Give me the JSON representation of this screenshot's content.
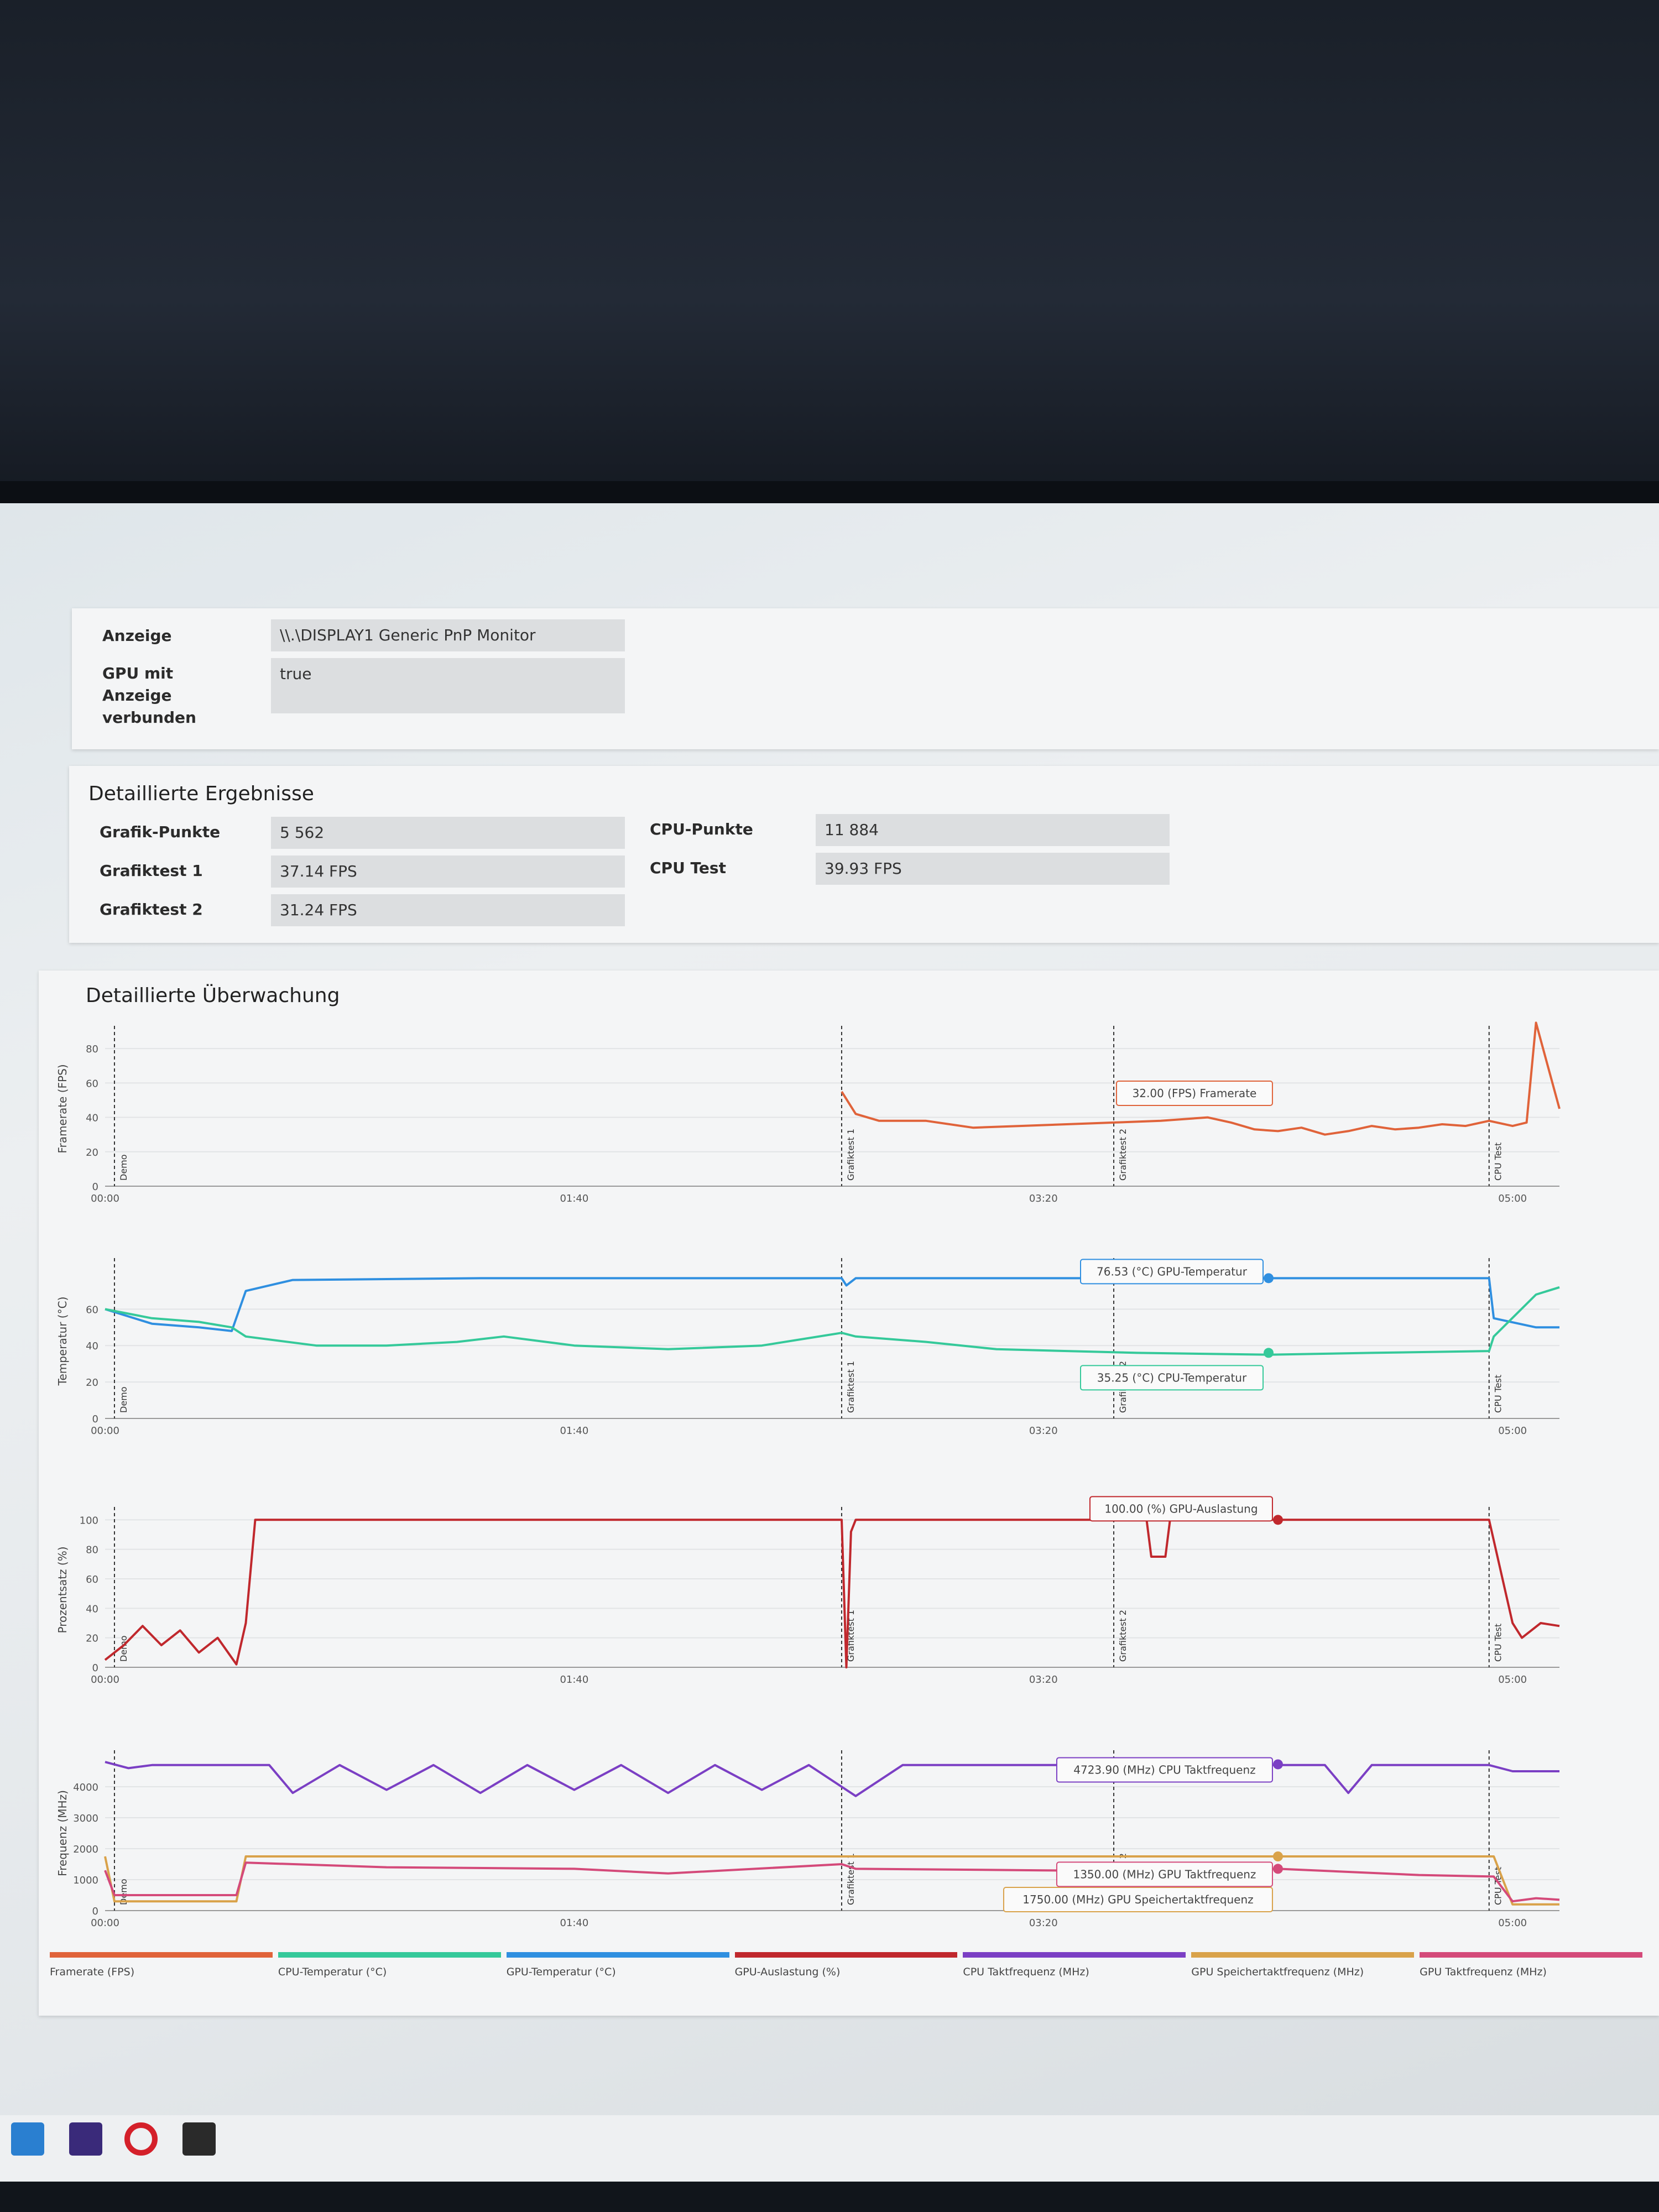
{
  "display": {
    "rows": [
      {
        "label": "Anzeige",
        "value": "\\\\.\\DISPLAY1 Generic PnP Monitor"
      },
      {
        "label": "GPU mit Anzeige verbunden",
        "value": "true"
      }
    ]
  },
  "results": {
    "title": "Detaillierte Ergebnisse",
    "left": [
      {
        "label": "Grafik-Punkte",
        "value": "5 562"
      },
      {
        "label": "Grafiktest 1",
        "value": "37.14 FPS"
      },
      {
        "label": "Grafiktest 2",
        "value": "31.24 FPS"
      }
    ],
    "right": [
      {
        "label": "CPU-Punkte",
        "value": "11 884"
      },
      {
        "label": "CPU Test",
        "value": "39.93 FPS"
      }
    ]
  },
  "monitoring": {
    "title": "Detaillierte Überwachung",
    "phase_labels": [
      "Demo",
      "Grafiktest 1",
      "Grafiktest 2",
      "CPU Test"
    ],
    "tooltips": {
      "fps": "32.00 (FPS) Framerate",
      "gpu_temp": "76.53 (°C) GPU-Temperatur",
      "cpu_temp": "35.25 (°C) CPU-Temperatur",
      "gpu_load": "100.00 (%) GPU-Auslastung",
      "cpu_clock": "4723.90 (MHz) CPU Taktfrequenz",
      "gpu_mem_clock": "1750.00 (MHz) GPU Speichertaktfrequenz",
      "gpu_clock": "1350.00 (MHz) GPU Taktfrequenz"
    }
  },
  "legend": [
    {
      "label": "Framerate (FPS)",
      "color": "#e0633a"
    },
    {
      "label": "CPU-Temperatur (°C)",
      "color": "#35c99a"
    },
    {
      "label": "GPU-Temperatur (°C)",
      "color": "#2f8fe0"
    },
    {
      "label": "GPU-Auslastung (%)",
      "color": "#c0282d"
    },
    {
      "label": "CPU Taktfrequenz (MHz)",
      "color": "#7b3fc4"
    },
    {
      "label": "GPU Speichertaktfrequenz (MHz)",
      "color": "#d9a24a"
    },
    {
      "label": "GPU Taktfrequenz (MHz)",
      "color": "#d44a7a"
    }
  ],
  "chart_data": [
    {
      "type": "line",
      "ylabel": "Framerate (FPS)",
      "ylim": [
        0,
        90
      ],
      "yticks": [
        0,
        20,
        40,
        60,
        80
      ],
      "xlabels": [
        "00:00",
        "01:40",
        "03:20",
        "05:00"
      ],
      "xlim": [
        0,
        310
      ],
      "series": [
        {
          "name": "Framerate (FPS)",
          "color": "#e0633a",
          "x": [
            157,
            160,
            165,
            175,
            185,
            195,
            205,
            215,
            225,
            235,
            240,
            245,
            250,
            255,
            260,
            265,
            270,
            275,
            280,
            285,
            290,
            295,
            300,
            303,
            305,
            310
          ],
          "y": [
            55,
            42,
            38,
            38,
            34,
            35,
            36,
            37,
            38,
            40,
            37,
            33,
            32,
            34,
            30,
            32,
            35,
            33,
            34,
            36,
            35,
            38,
            35,
            37,
            95,
            45
          ]
        }
      ]
    },
    {
      "type": "line",
      "ylabel": "Temperatur (°C)",
      "ylim": [
        0,
        85
      ],
      "yticks": [
        0,
        20,
        40,
        60
      ],
      "xlabels": [
        "00:00",
        "01:40",
        "03:20",
        "05:00"
      ],
      "xlim": [
        0,
        310
      ],
      "series": [
        {
          "name": "GPU-Temperatur (°C)",
          "color": "#2f8fe0",
          "x": [
            0,
            10,
            20,
            27,
            30,
            40,
            80,
            120,
            157,
            158,
            160,
            200,
            240,
            280,
            295,
            296,
            305,
            310
          ],
          "y": [
            60,
            52,
            50,
            48,
            70,
            76,
            77,
            77,
            77,
            73,
            77,
            77,
            77,
            77,
            77,
            55,
            50,
            50
          ],
          "markers": [
            [
              248,
              77
            ]
          ]
        },
        {
          "name": "CPU-Temperatur (°C)",
          "color": "#35c99a",
          "x": [
            0,
            10,
            20,
            27,
            30,
            45,
            60,
            75,
            85,
            100,
            120,
            140,
            157,
            160,
            175,
            190,
            220,
            248,
            270,
            295,
            296,
            305,
            310
          ],
          "y": [
            60,
            55,
            53,
            50,
            45,
            40,
            40,
            42,
            45,
            40,
            38,
            40,
            47,
            45,
            42,
            38,
            36,
            35,
            36,
            37,
            45,
            68,
            72
          ],
          "markers": [
            [
              248,
              36
            ]
          ]
        }
      ]
    },
    {
      "type": "line",
      "ylabel": "Prozentsatz (%)",
      "ylim": [
        0,
        105
      ],
      "yticks": [
        0,
        20,
        40,
        60,
        80,
        100
      ],
      "xlabels": [
        "00:00",
        "01:40",
        "03:20",
        "05:00"
      ],
      "xlim": [
        0,
        310
      ],
      "series": [
        {
          "name": "GPU-Auslastung (%)",
          "color": "#c0282d",
          "x": [
            0,
            4,
            8,
            12,
            16,
            20,
            24,
            28,
            30,
            32,
            50,
            100,
            157,
            158,
            159,
            160,
            200,
            222,
            223,
            226,
            227,
            250,
            295,
            300,
            302,
            306,
            310
          ],
          "y": [
            5,
            15,
            28,
            15,
            25,
            10,
            20,
            2,
            30,
            100,
            100,
            100,
            100,
            0,
            92,
            100,
            100,
            100,
            75,
            75,
            100,
            100,
            100,
            30,
            20,
            30,
            28
          ],
          "markers": [
            [
              250,
              100
            ]
          ]
        }
      ]
    },
    {
      "type": "line",
      "ylabel": "Frequenz (MHz)",
      "ylim": [
        0,
        5000
      ],
      "yticks": [
        0,
        1000,
        2000,
        3000,
        4000
      ],
      "xlabels": [
        "00:00",
        "01:40",
        "03:20",
        "05:00"
      ],
      "xlim": [
        0,
        310
      ],
      "series": [
        {
          "name": "CPU Taktfrequenz (MHz)",
          "color": "#7b3fc4",
          "x": [
            0,
            5,
            10,
            35,
            40,
            50,
            60,
            70,
            80,
            90,
            100,
            110,
            120,
            130,
            140,
            150,
            160,
            170,
            180,
            200,
            240,
            260,
            265,
            270,
            295,
            300,
            310
          ],
          "y": [
            4800,
            4600,
            4700,
            4700,
            3800,
            4700,
            3900,
            4700,
            3800,
            4700,
            3900,
            4700,
            3800,
            4700,
            3900,
            4700,
            3700,
            4700,
            4700,
            4700,
            4700,
            4700,
            3800,
            4700,
            4700,
            4500,
            4500
          ],
          "markers": [
            [
              250,
              4724
            ]
          ]
        },
        {
          "name": "GPU Speichertaktfrequenz (MHz)",
          "color": "#d9a24a",
          "x": [
            0,
            2,
            5,
            28,
            30,
            60,
            157,
            250,
            296,
            300,
            310
          ],
          "y": [
            1750,
            300,
            300,
            300,
            1750,
            1750,
            1750,
            1750,
            1750,
            200,
            200
          ],
          "markers": [
            [
              250,
              1750
            ]
          ]
        },
        {
          "name": "GPU Taktfrequenz (MHz)",
          "color": "#d44a7a",
          "x": [
            0,
            2,
            5,
            28,
            30,
            60,
            100,
            120,
            157,
            160,
            200,
            230,
            250,
            280,
            296,
            300,
            305,
            310
          ],
          "y": [
            1300,
            500,
            500,
            500,
            1550,
            1400,
            1350,
            1200,
            1500,
            1350,
            1300,
            1250,
            1350,
            1150,
            1100,
            300,
            400,
            350
          ],
          "markers": [
            [
              250,
              1350
            ]
          ]
        }
      ]
    }
  ]
}
